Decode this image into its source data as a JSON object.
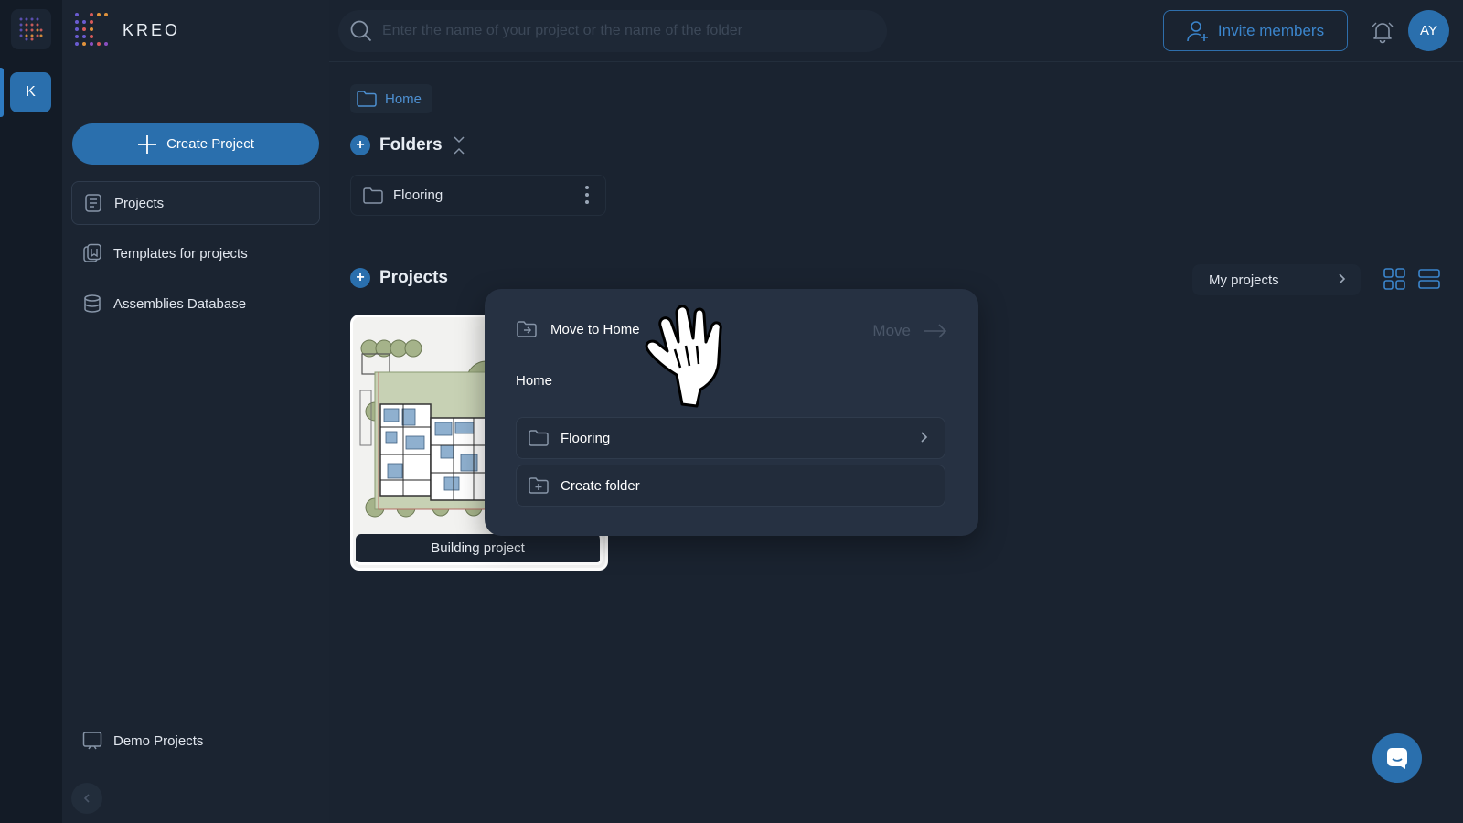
{
  "app": {
    "brand_name": "KREO",
    "company_initial": "K"
  },
  "sidebar": {
    "create_label": "Create Project",
    "items": [
      {
        "label": "Projects",
        "icon": "projects-list-icon"
      },
      {
        "label": "Templates for projects",
        "icon": "templates-icon"
      },
      {
        "label": "Assemblies Database",
        "icon": "database-icon"
      }
    ],
    "demo_label": "Demo Projects"
  },
  "topbar": {
    "search_placeholder": "Enter the name of your project or the name of the folder",
    "invite_label": "Invite members",
    "avatar_initials": "AY"
  },
  "main": {
    "breadcrumb": "Home",
    "folders_title": "Folders",
    "folders": [
      {
        "name": "Flooring"
      }
    ],
    "projects_title": "Projects",
    "filter_label": "My projects",
    "projects": [
      {
        "name": "Building project"
      }
    ]
  },
  "move_popup": {
    "title": "Move to Home",
    "action_label": "Move",
    "location": "Home",
    "folders": [
      {
        "name": "Flooring"
      }
    ],
    "create_folder_label": "Create folder"
  },
  "colors": {
    "accent": "#2a6fad",
    "background": "#1a2330",
    "sidebar": "#1b2431",
    "popup": "#263142"
  }
}
